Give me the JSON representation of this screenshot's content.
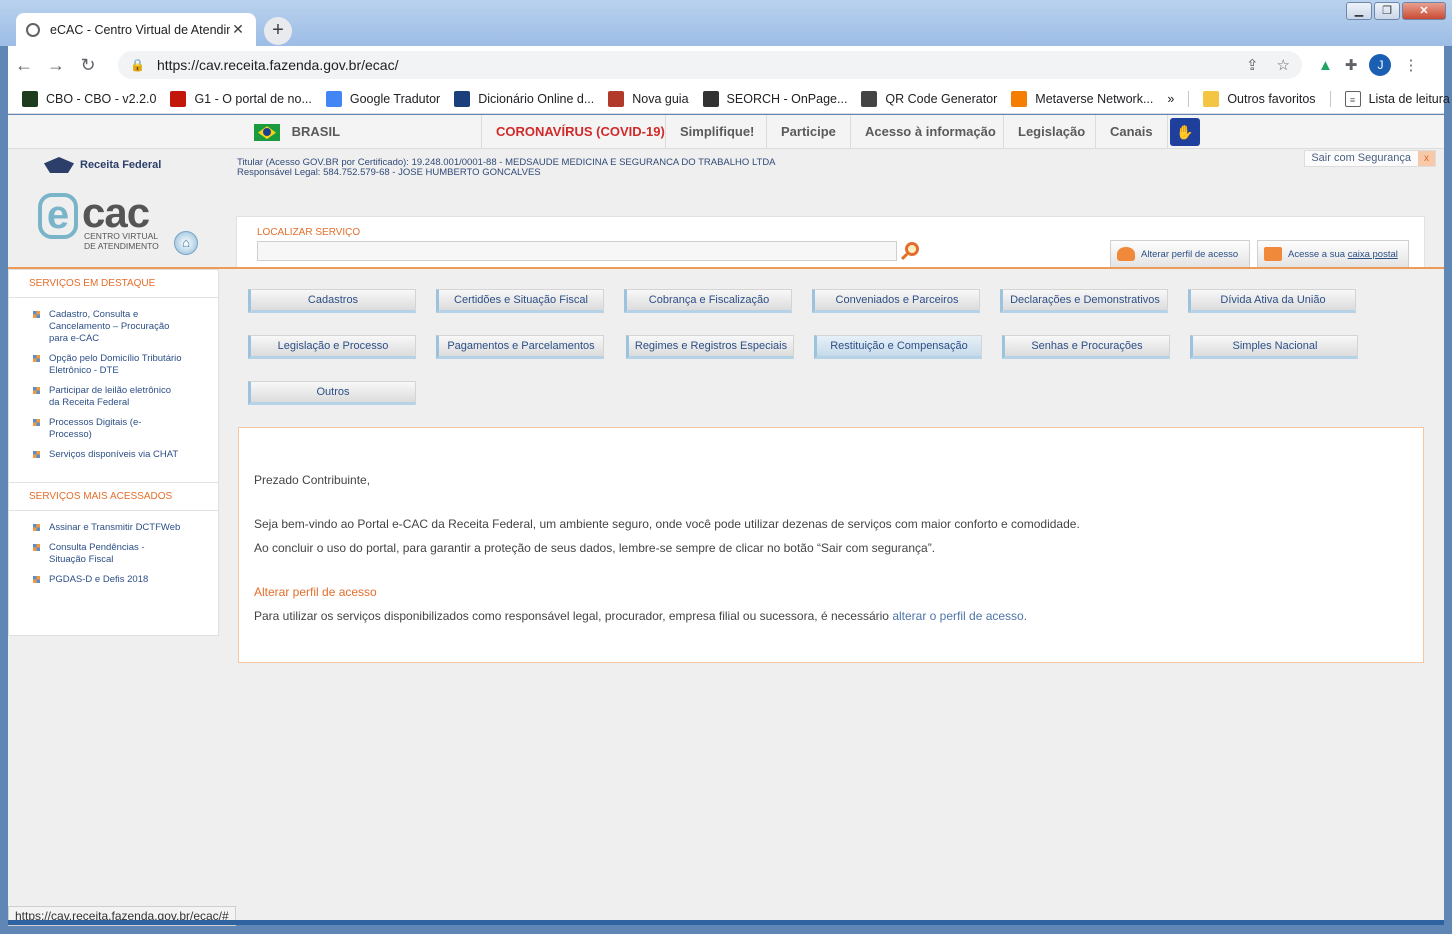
{
  "browser": {
    "tab_title": "eCAC - Centro Virtual de Atendimento",
    "new_tab": "+",
    "url": "https://cav.receita.fazenda.gov.br/ecac/",
    "avatar_letter": "J",
    "bookmarks": [
      {
        "label": "CBO - CBO - v2.2.0",
        "icon": "mte-icon",
        "color": "#1e3d1e"
      },
      {
        "label": "G1 - O portal de no...",
        "icon": "g1-icon",
        "color": "#c4170c"
      },
      {
        "label": "Google Tradutor",
        "icon": "translate-icon",
        "color": "#4285f4"
      },
      {
        "label": "Dicionário Online d...",
        "icon": "dictionary-icon",
        "color": "#1a3f7a"
      },
      {
        "label": "Nova guia",
        "icon": "butterfly-icon",
        "color": "#b23a2a"
      },
      {
        "label": "SEORCH - OnPage...",
        "icon": "seorch-icon",
        "color": "#333333"
      },
      {
        "label": "QR Code Generator",
        "icon": "qr-icon",
        "color": "#444444"
      },
      {
        "label": "Metaverse Network...",
        "icon": "blogger-icon",
        "color": "#f57d00"
      }
    ],
    "more": "»",
    "other_favorites": "Outros favoritos",
    "reading_list": "Lista de leitura",
    "status_url": "https://cav.receita.fazenda.gov.br/ecac/#"
  },
  "govbar": {
    "country": "BRASIL",
    "items": [
      "CORONAVÍRUS (COVID-19)",
      "Simplifique!",
      "Participe",
      "Acesso à informação",
      "Legislação",
      "Canais"
    ]
  },
  "header": {
    "logout": "Sair com Segurança",
    "logout_x": "x",
    "rf_logo": "Receita Federal",
    "ecac_e": "e",
    "ecac_cac": "cac",
    "ecac_sub1": "CENTRO VIRTUAL",
    "ecac_sub2": "DE ATENDIMENTO",
    "titular": "Titular (Acesso GOV.BR por Certificado): 19.248.001/0001-88 - MEDSAUDE MEDICINA E SEGURANCA DO TRABALHO LTDA",
    "responsavel": "Responsável Legal: 584.752.579-68 - JOSE HUMBERTO GONCALVES"
  },
  "search": {
    "label": "LOCALIZAR SERVIÇO",
    "value": "",
    "profile_btn": "Alterar perfil de acesso",
    "mailbox_prefix": "Acesse a sua",
    "mailbox_link": "caixa postal"
  },
  "sidebar": {
    "featured_title": "SERVIÇOS EM DESTAQUE",
    "featured": [
      [
        "Cadastro, Consulta e",
        "Cancelamento – Procuração",
        "para e-CAC"
      ],
      [
        "Opção pelo Domicílio Tributário",
        "Eletrônico - DTE"
      ],
      [
        "Participar de leilão eletrônico",
        "da Receita Federal"
      ],
      [
        "Processos Digitais (e-",
        "Processo)"
      ],
      [
        "Serviços disponíveis via CHAT"
      ]
    ],
    "most_title": "SERVIÇOS MAIS ACESSADOS",
    "most": [
      [
        "Assinar e Transmitir DCTFWeb"
      ],
      [
        "Consulta Pendências -",
        "Situação Fiscal"
      ],
      [
        "PGDAS-D e Defis 2018"
      ]
    ]
  },
  "categories": [
    "Cadastros",
    "Certidões e Situação Fiscal",
    "Cobrança e Fiscalização",
    "Conveniados e Parceiros",
    "Declarações e Demonstrativos",
    "Dívida Ativa da União",
    "Legislação e Processo",
    "Pagamentos e Parcelamentos",
    "Regimes e Registros Especiais",
    "Restituição e Compensação",
    "Senhas e Procurações",
    "Simples Nacional",
    "Outros"
  ],
  "welcome": {
    "greeting": "Prezado Contribuinte,",
    "line1": "Seja bem-vindo ao Portal e-CAC da Receita Federal, um ambiente seguro, onde você pode utilizar dezenas de serviços com maior conforto e comodidade.",
    "line2": "Ao concluir o uso do portal, para garantir a proteção de seus dados, lembre-se sempre de clicar no botão “Sair com segurança”.",
    "profile_title": "Alterar perfil de acesso",
    "profile_text": "Para utilizar os serviços disponibilizados como responsável legal, procurador, empresa filial ou sucessora, é necessário",
    "profile_link": "alterar o perfil de acesso."
  }
}
